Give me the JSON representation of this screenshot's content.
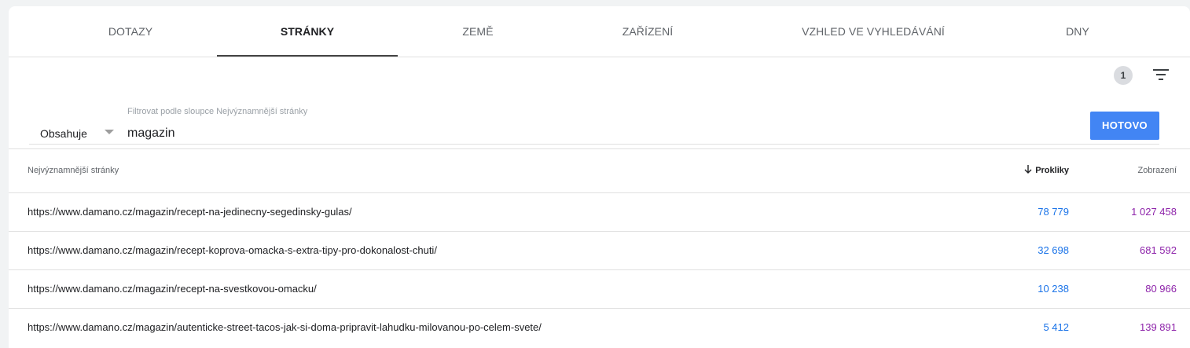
{
  "tabs": [
    {
      "label": "DOTAZY",
      "active": false
    },
    {
      "label": "STRÁNKY",
      "active": true
    },
    {
      "label": "ZEMĚ",
      "active": false
    },
    {
      "label": "ZAŘÍZENÍ",
      "active": false
    },
    {
      "label": "VZHLED VE VYHLEDÁVÁNÍ",
      "active": false
    },
    {
      "label": "DNY",
      "active": false
    }
  ],
  "filter_toolbar": {
    "active_filter_count": "1",
    "icon": "filter-list-icon"
  },
  "filter": {
    "label": "Filtrovat podle sloupce Nejvýznamnější stránky",
    "operator": "Obsahuje",
    "value": "magazin",
    "done_label": "HOTOVO"
  },
  "table": {
    "columns": {
      "page": "Nejvýznamnější stránky",
      "clicks": "Prokliky",
      "impressions": "Zobrazení"
    },
    "sort_column": "clicks",
    "rows": [
      {
        "url": "https://www.damano.cz/magazin/recept-na-jedinecny-segedinsky-gulas/",
        "clicks": "78 779",
        "impressions": "1 027 458"
      },
      {
        "url": "https://www.damano.cz/magazin/recept-koprova-omacka-s-extra-tipy-pro-dokonalost-chuti/",
        "clicks": "32 698",
        "impressions": "681 592"
      },
      {
        "url": "https://www.damano.cz/magazin/recept-na-svestkovou-omacku/",
        "clicks": "10 238",
        "impressions": "80 966"
      },
      {
        "url": "https://www.damano.cz/magazin/autenticke-street-tacos-jak-si-doma-pripravit-lahudku-milovanou-po-celem-svete/",
        "clicks": "5 412",
        "impressions": "139 891"
      }
    ]
  },
  "colors": {
    "accent": "#4285f4",
    "clicks": "#1a73e8",
    "impressions": "#8e24aa"
  }
}
